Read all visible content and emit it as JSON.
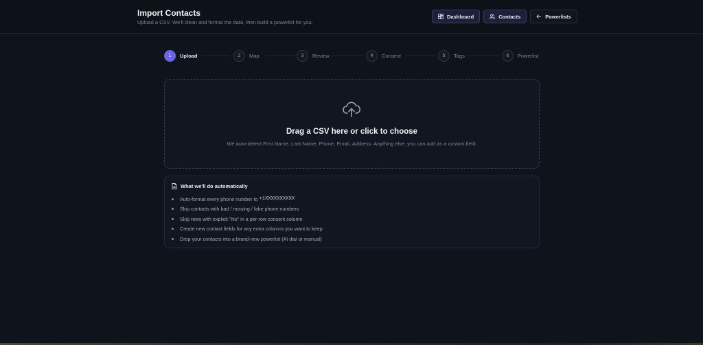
{
  "header": {
    "title": "Import Contacts",
    "subtitle": "Upload a CSV. We'll clean and format the data, then build a powerlist for you."
  },
  "nav": [
    {
      "label": "Dashboard",
      "icon": "dashboard-icon"
    },
    {
      "label": "Contacts",
      "icon": "users-icon"
    },
    {
      "label": "Powerlists",
      "icon": "arrow-left-icon"
    }
  ],
  "steps": [
    {
      "num": "1",
      "label": "Upload",
      "active": true
    },
    {
      "num": "2",
      "label": "Map"
    },
    {
      "num": "3",
      "label": "Review"
    },
    {
      "num": "4",
      "label": "Consent"
    },
    {
      "num": "5",
      "label": "Tags"
    },
    {
      "num": "6",
      "label": "Powerlist"
    }
  ],
  "dropzone": {
    "icon": "cloud-upload-icon",
    "title": "Drag a CSV here or click to choose",
    "subtitle": "We auto-detect First Name, Last Name, Phone, Email, Address. Anything else, you can add as a custom field."
  },
  "info": {
    "icon": "document-icon",
    "heading": "What we'll do automatically",
    "items": [
      {
        "text": "Auto-format every phone number to ",
        "code": "+1XXXXXXXXXX"
      },
      {
        "text": "Skip contacts with bad / missing / fake phone numbers"
      },
      {
        "text": "Skip rows with explicit \"No\" in a per-row consent column"
      },
      {
        "text": "Create new contact fields for any extra columns you want to keep"
      },
      {
        "text": "Drop your contacts into a brand-new powerlist (AI dial or manual)"
      }
    ]
  },
  "colors": {
    "accent": "#6b64e8",
    "background": "#0f131b"
  }
}
